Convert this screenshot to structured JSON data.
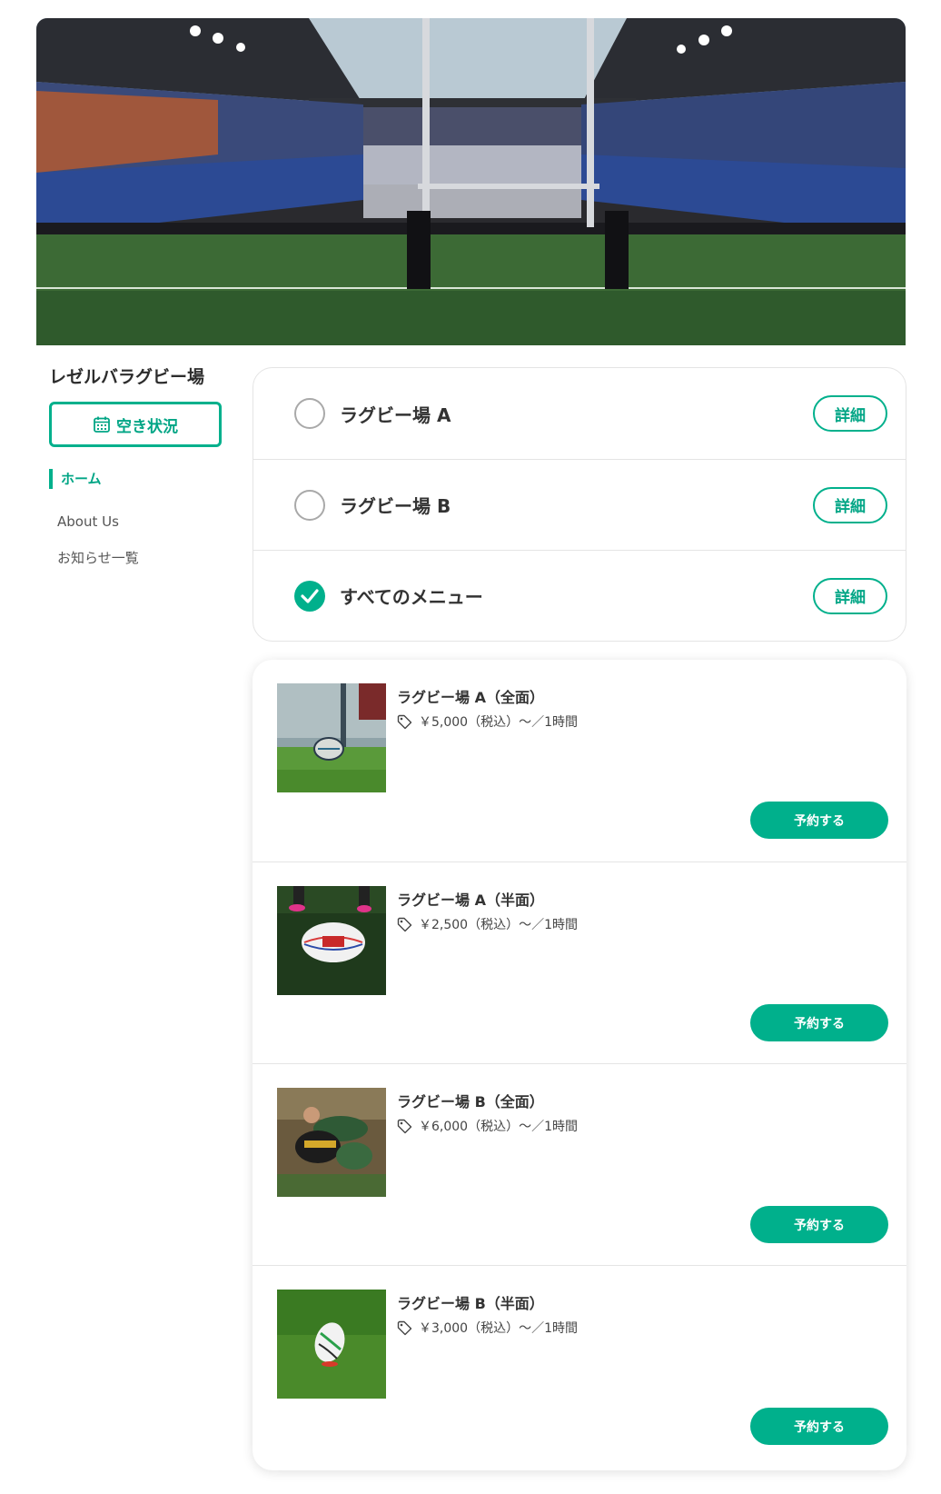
{
  "brand": {
    "accent": "#00b08c"
  },
  "hero": {
    "image": "rugby-stadium-goalposts"
  },
  "sidebar": {
    "site_title": "レゼルバラグビー場",
    "availability_button": "空き状況",
    "nav": [
      {
        "label": "ホーム",
        "active": true
      },
      {
        "label": "About Us",
        "active": false
      },
      {
        "label": "お知らせ一覧",
        "active": false
      }
    ]
  },
  "filters": [
    {
      "label": "ラグビー場 A",
      "checked": false,
      "detail_label": "詳細"
    },
    {
      "label": "ラグビー場 B",
      "checked": false,
      "detail_label": "詳細"
    },
    {
      "label": "すべてのメニュー",
      "checked": true,
      "detail_label": "詳細"
    }
  ],
  "menus": [
    {
      "title": "ラグビー場 A（全面）",
      "price": "￥5,000（税込）〜／1時間",
      "book_label": "予約する",
      "image": "rugby-ball-kick-photo"
    },
    {
      "title": "ラグビー場 A（半面）",
      "price": "￥2,500（税込）〜／1時間",
      "book_label": "予約する",
      "image": "rugby-ball-on-turf-photo"
    },
    {
      "title": "ラグビー場 B（全面）",
      "price": "￥6,000（税込）〜／1時間",
      "book_label": "予約する",
      "image": "rugby-tackle-photo"
    },
    {
      "title": "ラグビー場 B（半面）",
      "price": "￥3,000（税込）〜／1時間",
      "book_label": "予約する",
      "image": "rugby-ball-on-tee-photo"
    }
  ]
}
